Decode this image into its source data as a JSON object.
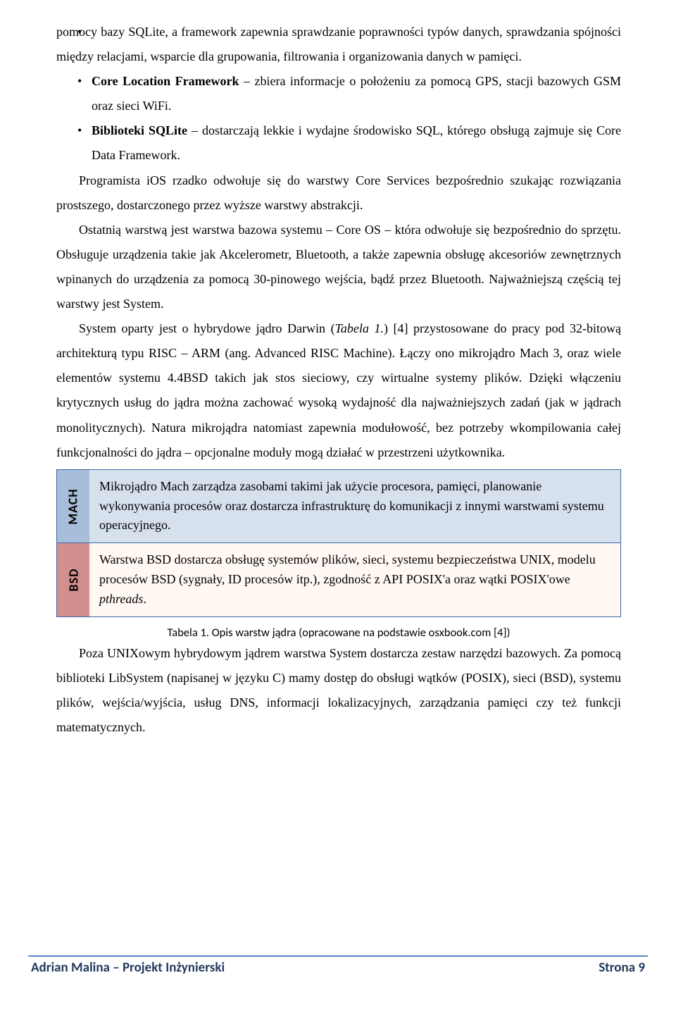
{
  "bullet_intro": "pomocy bazy SQLite, a framework zapewnia sprawdzanie poprawności typów danych, sprawdzania spójności między relacjami, wsparcie dla grupowania, filtrowania i organizowania danych w pamięci.",
  "bullets": [
    {
      "bold": "Core Location Framework",
      "rest": " – zbiera informacje o położeniu za pomocą GPS, stacji bazowych GSM oraz sieci WiFi."
    },
    {
      "bold": "Biblioteki SQLite",
      "rest": " – dostarczają lekkie i wydajne środowisko SQL, którego obsługą zajmuje się Core Data Framework."
    }
  ],
  "para1": "Programista iOS rzadko odwołuje się do warstwy Core Services bezpośrednio szukając rozwiązania prostszego, dostarczonego przez wyższe warstwy abstrakcji.",
  "para2": "Ostatnią warstwą jest warstwa bazowa systemu – Core OS – która odwołuje się bezpośrednio do sprzętu. Obsługuje urządzenia takie jak Akcelerometr, Bluetooth, a także zapewnia obsługę akcesoriów zewnętrznych wpinanych do urządzenia za pomocą 30-pinowego wejścia, bądź przez Bluetooth. Najważniejszą częścią tej warstwy jest System.",
  "para3_a": "System oparty jest o hybrydowe jądro Darwin (",
  "para3_it": "Tabela 1.",
  "para3_b": ") [4] przystosowane do pracy pod 32-bitową architekturą typu RISC – ARM (ang. Advanced RISC Machine). Łączy ono mikrojądro Mach 3, oraz wiele elementów systemu 4.4BSD takich jak stos sieciowy, czy wirtualne systemy plików. Dzięki włączeniu krytycznych usług do jądra można zachować wysoką wydajność dla najważniejszych zadań (jak w jądrach monolitycznych). Natura mikrojądra natomiast zapewnia modułowość, bez potrzeby wkompilowania całej funkcjonalności do jądra – opcjonalne moduły mogą działać w przestrzeni użytkownika.",
  "table": {
    "mach": {
      "label": "MACH",
      "text": "Mikrojądro Mach zarządza zasobami takimi jak użycie procesora, pamięci, planowanie wykonywania procesów oraz dostarcza infrastrukturę do komunikacji z innymi warstwami systemu operacyjnego."
    },
    "bsd_label": "BSD",
    "bsd_a": "Warstwa BSD dostarcza obsługę systemów plików, sieci, systemu bezpieczeństwa UNIX, modelu procesów BSD (sygnały, ID procesów itp.), zgodność z API POSIX'a oraz wątki POSIX'owe ",
    "bsd_it": "pthreads",
    "bsd_b": "."
  },
  "caption": "Tabela 1. Opis warstw jądra (opracowane na podstawie osxbook.com [4])",
  "para4": "Poza UNIXowym hybrydowym jądrem warstwa System dostarcza zestaw narzędzi bazowych. Za pomocą biblioteki LibSystem (napisanej w języku C) mamy dostęp do obsługi wątków (POSIX), sieci (BSD), systemu plików, wejścia/wyjścia, usług DNS, informacji lokalizacyjnych, zarządzania pamięci czy też funkcji matematycznych.",
  "footer": {
    "left": "Adrian Malina – Projekt Inżynierski",
    "right": "Strona 9"
  }
}
